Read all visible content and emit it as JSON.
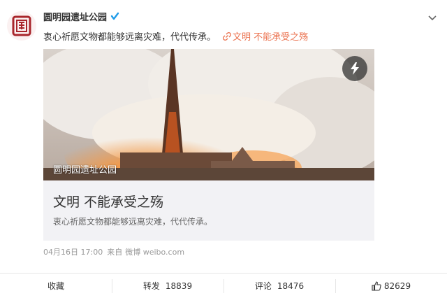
{
  "post": {
    "account_name": "圆明园遗址公园",
    "text": "衷心祈愿文物都能够远离灾难，代代传承。",
    "topic_link": "文明 不能承受之殇",
    "time": "04月16日 17:00",
    "source_prefix": "来自",
    "source": "微博 weibo.com"
  },
  "article": {
    "watermark": "圆明园遗址公园",
    "title": "文明 不能承受之殇",
    "description": "衷心祈愿文物都能够远离灾难，代代传承。"
  },
  "actions": {
    "favorite_label": "收藏",
    "repost_label": "转发",
    "repost_count": "18839",
    "comment_label": "评论",
    "comment_count": "18476",
    "like_count": "82629"
  },
  "colors": {
    "brand_red": "#a8262c",
    "link_orange": "#eb7350",
    "verified_blue": "#1f9be8"
  },
  "icons": [
    "logo-icon",
    "verified-icon",
    "chevron-down-icon",
    "link-icon",
    "lightning-icon",
    "thumbs-up-icon"
  ]
}
